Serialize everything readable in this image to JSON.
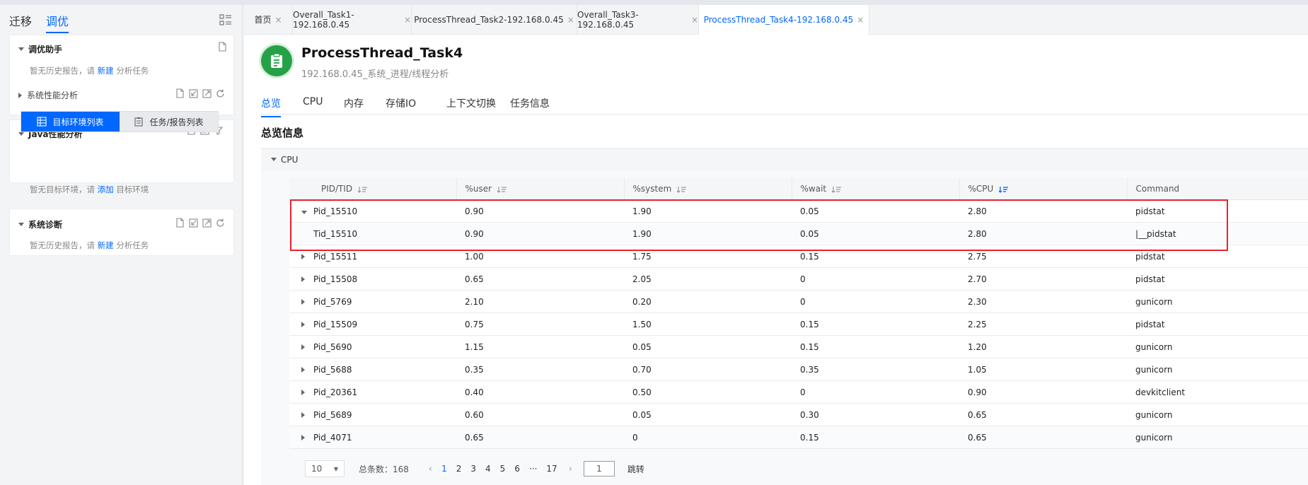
{
  "sidebar": {
    "tabs": [
      {
        "label": "迁移"
      },
      {
        "label": "调优"
      }
    ],
    "tuning_assistant": {
      "title": "调优助手",
      "note_prefix": "暂无历史报告，请",
      "note_link": "新建",
      "note_suffix": "分析任务",
      "sub": "系统性能分析"
    },
    "java_perf": {
      "title": "Java性能分析",
      "seg_active": "目标环境列表",
      "seg_inactive": "任务/报告列表",
      "note_prefix": "暂无目标环境，请",
      "note_link": "添加",
      "note_suffix": "目标环境"
    },
    "sys_diag": {
      "title": "系统诊断",
      "note_prefix": "暂无历史报告，请",
      "note_link": "新建",
      "note_suffix": "分析任务"
    }
  },
  "tabs": [
    {
      "label": "首页"
    },
    {
      "label": "Overall_Task1-192.168.0.45"
    },
    {
      "label": "ProcessThread_Task2-192.168.0.45"
    },
    {
      "label": "Overall_Task3-192.168.0.45"
    },
    {
      "label": "ProcessThread_Task4-192.168.0.45"
    }
  ],
  "task": {
    "title": "ProcessThread_Task4",
    "subtitle": "192.168.0.45_系统_进程/线程分析"
  },
  "subnav": [
    {
      "label": "总览"
    },
    {
      "label": "CPU"
    },
    {
      "label": "内存"
    },
    {
      "label": "存储IO"
    },
    {
      "label": "上下文切换"
    },
    {
      "label": "任务信息"
    }
  ],
  "section_title": "总览信息",
  "collapse_label": "CPU",
  "table": {
    "headers": [
      "PID/TID",
      "%user",
      "%system",
      "%wait",
      "%CPU",
      "Command"
    ],
    "rows": [
      {
        "id": "Pid_15510",
        "user": "0.90",
        "system": "1.90",
        "wait": "0.05",
        "cpu": "2.80",
        "command": "pidstat"
      },
      {
        "id": "Tid_15510",
        "user": "0.90",
        "system": "1.90",
        "wait": "0.05",
        "cpu": "2.80",
        "command": "|__pidstat"
      },
      {
        "id": "Pid_15511",
        "user": "1.00",
        "system": "1.75",
        "wait": "0.15",
        "cpu": "2.75",
        "command": "pidstat"
      },
      {
        "id": "Pid_15508",
        "user": "0.65",
        "system": "2.05",
        "wait": "0",
        "cpu": "2.70",
        "command": "pidstat"
      },
      {
        "id": "Pid_5769",
        "user": "2.10",
        "system": "0.20",
        "wait": "0",
        "cpu": "2.30",
        "command": "gunicorn"
      },
      {
        "id": "Pid_15509",
        "user": "0.75",
        "system": "1.50",
        "wait": "0.15",
        "cpu": "2.25",
        "command": "pidstat"
      },
      {
        "id": "Pid_5690",
        "user": "1.15",
        "system": "0.05",
        "wait": "0.15",
        "cpu": "1.20",
        "command": "gunicorn"
      },
      {
        "id": "Pid_5688",
        "user": "0.35",
        "system": "0.70",
        "wait": "0.35",
        "cpu": "1.05",
        "command": "gunicorn"
      },
      {
        "id": "Pid_20361",
        "user": "0.40",
        "system": "0.50",
        "wait": "0",
        "cpu": "0.90",
        "command": "devkitclient"
      },
      {
        "id": "Pid_5689",
        "user": "0.60",
        "system": "0.05",
        "wait": "0.30",
        "cpu": "0.65",
        "command": "gunicorn"
      },
      {
        "id": "Pid_4071",
        "user": "0.65",
        "system": "0",
        "wait": "0.15",
        "cpu": "0.65",
        "command": "gunicorn"
      }
    ]
  },
  "pager": {
    "page_size": "10",
    "total": "总条数：168",
    "pages": [
      "1",
      "2",
      "3",
      "4",
      "5",
      "6",
      "···",
      "17"
    ],
    "jump_value": "1",
    "jump_label": "跳转"
  },
  "colors": {
    "accent": "#0067ff",
    "highlight": "#e8232f",
    "app_icon": "#27a148"
  }
}
